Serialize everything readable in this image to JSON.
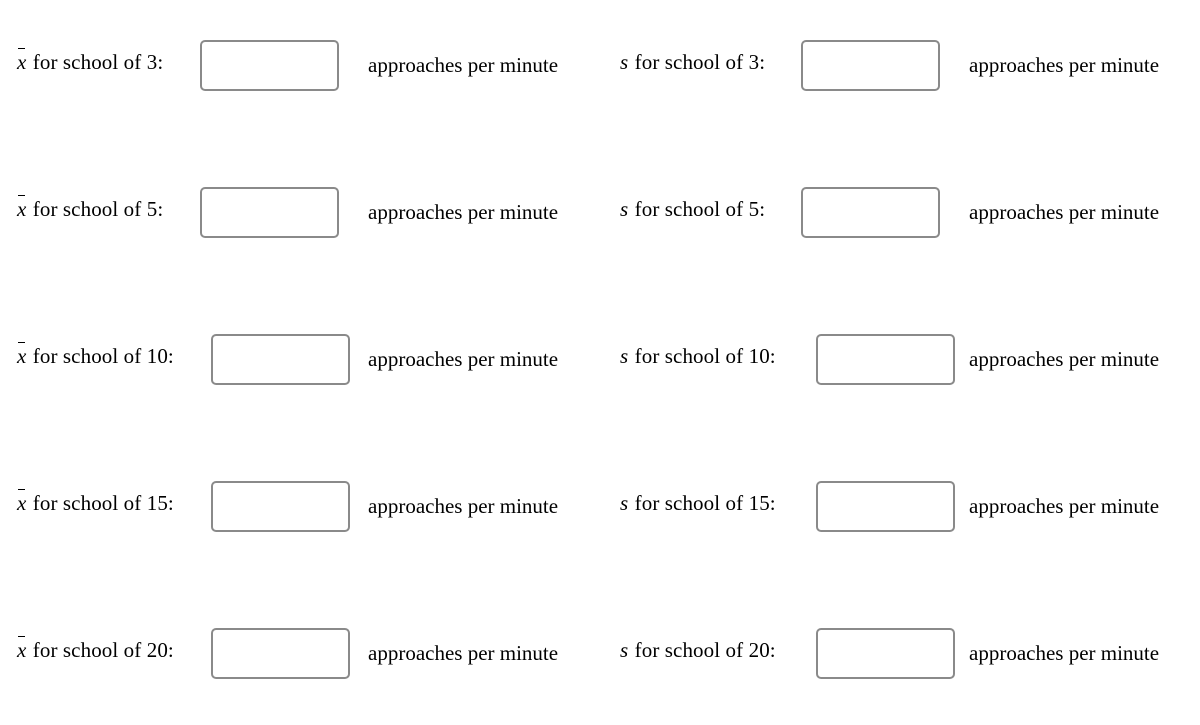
{
  "page": {
    "background_color": "#ffffff",
    "text_color": "#000000",
    "input_border_color": "#8a8a8a"
  },
  "worksheet": {
    "unit_label": "approaches per minute",
    "label_connector": " for school of ",
    "label_suffix": ":",
    "columns": [
      {
        "symbol": "x",
        "symbol_overbar": true,
        "symbol_name": "x-bar"
      },
      {
        "symbol": "s",
        "symbol_overbar": false,
        "symbol_name": "s"
      }
    ],
    "rows": [
      {
        "school_size": "3",
        "mean_label_symbol": "x",
        "mean_label_text": " for school of 3:",
        "mean_value": "",
        "mean_placeholder": "",
        "mean_unit": "approaches per minute",
        "sd_label_symbol": "s",
        "sd_label_text": " for school of 3:",
        "sd_value": "",
        "sd_placeholder": "",
        "sd_unit": "approaches per minute"
      },
      {
        "school_size": "5",
        "mean_label_symbol": "x",
        "mean_label_text": " for school of 5:",
        "mean_value": "",
        "mean_placeholder": "",
        "mean_unit": "approaches per minute",
        "sd_label_symbol": "s",
        "sd_label_text": " for school of 5:",
        "sd_value": "",
        "sd_placeholder": "",
        "sd_unit": "approaches per minute"
      },
      {
        "school_size": "10",
        "mean_label_symbol": "x",
        "mean_label_text": " for school of 10:",
        "mean_value": "",
        "mean_placeholder": "",
        "mean_unit": "approaches per minute",
        "sd_label_symbol": "s",
        "sd_label_text": " for school of 10:",
        "sd_value": "",
        "sd_placeholder": "",
        "sd_unit": "approaches per minute"
      },
      {
        "school_size": "15",
        "mean_label_symbol": "x",
        "mean_label_text": " for school of 15:",
        "mean_value": "",
        "mean_placeholder": "",
        "mean_unit": "approaches per minute",
        "sd_label_symbol": "s",
        "sd_label_text": " for school of 15:",
        "sd_value": "",
        "sd_placeholder": "",
        "sd_unit": "approaches per minute"
      },
      {
        "school_size": "20",
        "mean_label_symbol": "x",
        "mean_label_text": " for school of 20:",
        "mean_value": "",
        "mean_placeholder": "",
        "mean_unit": "approaches per minute",
        "sd_label_symbol": "s",
        "sd_label_text": " for school of 20:",
        "sd_value": "",
        "sd_placeholder": "",
        "sd_unit": "approaches per minute"
      }
    ]
  }
}
